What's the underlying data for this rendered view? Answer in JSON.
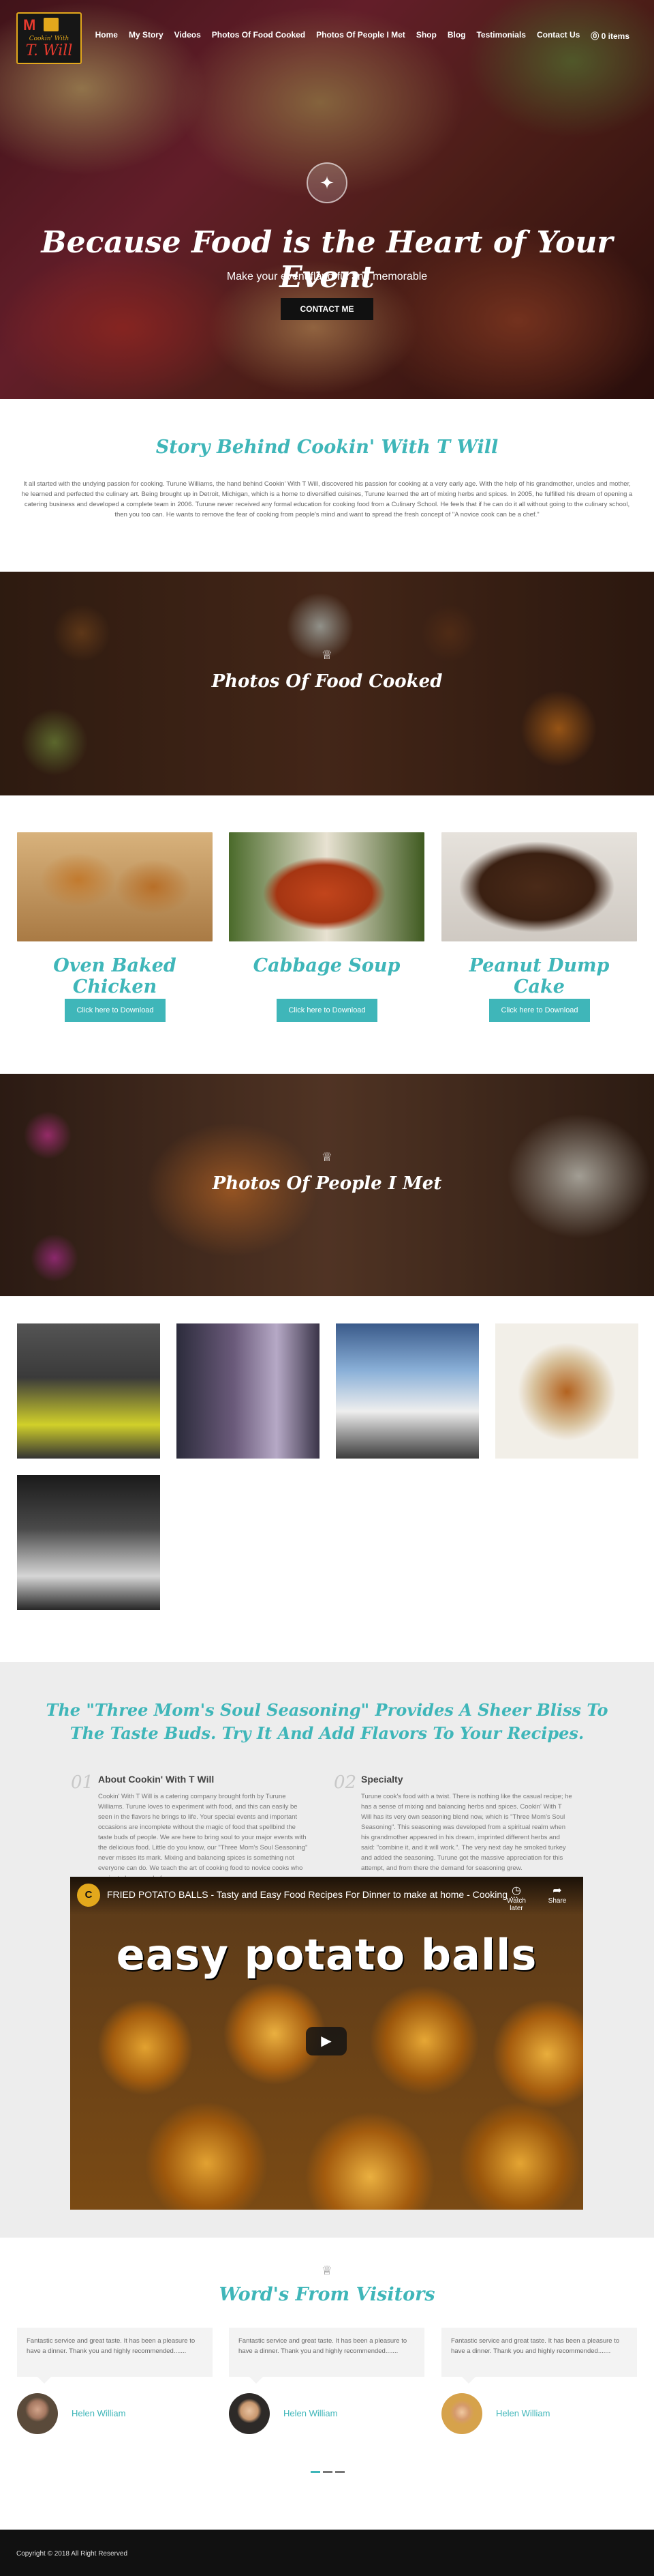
{
  "brand": {
    "logo_line1": "Cookin' With",
    "logo_line2": "T. Will"
  },
  "nav": {
    "items": [
      "Home",
      "My Story",
      "Videos",
      "Photos Of Food Cooked",
      "Photos Of People I Met",
      "Shop",
      "Blog",
      "Testimonials",
      "Contact Us",
      "⓪ 0 items"
    ]
  },
  "hero": {
    "icon": "fork-plate-icon",
    "title": "Because Food is the Heart of Your Event",
    "subtitle": "Make your event flavorful and memorable",
    "button": "CONTACT ME"
  },
  "story": {
    "title": "Story Behind Cookin' With T Will",
    "text": "It all started with the undying passion for cooking. Turune Williams, the hand behind Cookin' With T Will, discovered his passion for cooking at a very early age. With the help of his grandmother, uncles and mother, he learned and perfected the culinary art. Being brought up in Detroit, Michigan, which is a home to diversified cuisines, Turune learned the art of mixing herbs and spices. In 2005, he fulfilled his dream of opening a catering business and developed a complete team in 2006. Turune never received any formal education for cooking food from a Culinary School. He feels that if he can do it all without going to the culinary school, then you too can. He wants to remove the fear of cooking from people's mind and want to spread the fresh concept of \"A novice cook can be a chef.\""
  },
  "food_banner": {
    "icon": "crown-icon",
    "title": "Photos Of Food Cooked"
  },
  "food_cards": [
    {
      "title": "Oven Baked Chicken",
      "button": "Click here to Download"
    },
    {
      "title": "Cabbage Soup",
      "button": "Click here to Download"
    },
    {
      "title": "Peanut Dump Cake",
      "button": "Click here to Download"
    }
  ],
  "people_banner": {
    "icon": "crown-icon",
    "title": "Photos Of People I Met"
  },
  "seasoning": {
    "title": "The \"Three Mom's Soul Seasoning\" Provides A Sheer Bliss To The Taste Buds. Try It And Add Flavors To Your Recipes.",
    "col1": {
      "number": "01",
      "heading": "About Cookin' With T Will",
      "text": "Cookin' With T Will is a catering company brought forth by Turune Williams. Turune loves to experiment with food, and this can easily be seen in the flavors he brings to life. Your special events and important occasions are incomplete without the magic of food that spellbind the taste buds of people. We are here to bring soul to your major events with the delicious food. Little do you know, our \"Three Mom's Soul Seasoning\" never misses its mark. Mixing and balancing spices is something not everyone can do. We teach the art of cooking food to novice cooks who aspire to become chefs."
    },
    "col2": {
      "number": "02",
      "heading": "Specialty",
      "text": "Turune cook's food with a twist. There is nothing like the casual recipe; he has a sense of mixing and balancing herbs and spices. Cookin' With T Will has its very own seasoning blend now, which is \"Three Mom's Soul Seasoning\". This seasoning was developed from a spiritual realm when his grandmother appeared in his dream, imprinted different herbs and said: \"combine it, and it will work.\". The very next day he smoked turkey and added the seasoning. Turune got the massive appreciation for this attempt, and from there the demand for seasoning grew."
    }
  },
  "video": {
    "channel_initial": "C",
    "title": "FRIED POTATO BALLS - Tasty and Easy Food Recipes For Dinner to make at home - Cooking ...",
    "watch_later": "Watch later",
    "share": "Share",
    "overlay_text": "easy potato balls"
  },
  "testimonials": {
    "icon": "crown-icon",
    "title": "Word's From Visitors",
    "items": [
      {
        "quote": "Fantastic service and great taste. It has been a pleasure to have a dinner. Thank you and highly recommended.......",
        "name": "Helen William"
      },
      {
        "quote": "Fantastic service and great taste. It has been a pleasure to have a dinner. Thank you and highly recommended.......",
        "name": "Helen William"
      },
      {
        "quote": "Fantastic service and great taste. It has been a pleasure to have a dinner. Thank you and highly recommended.......",
        "name": "Helen William"
      }
    ]
  },
  "footer": {
    "copyright": "Copyright © 2018 All Right Reserved"
  },
  "colors": {
    "accent": "#3fb6b9",
    "footer": "#111111",
    "hero_button": "#111111"
  }
}
